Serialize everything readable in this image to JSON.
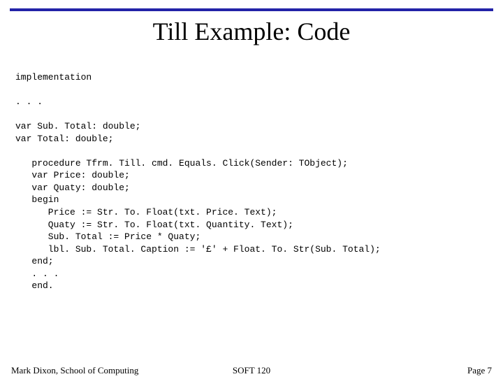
{
  "title": "Till Example: Code",
  "code": {
    "l0": "implementation",
    "l1": ". . .",
    "l2": "var Sub. Total: double;",
    "l3": "var Total: double;",
    "l4": "   procedure Tfrm. Till. cmd. Equals. Click(Sender: TObject);",
    "l5": "   var Price: double;",
    "l6": "   var Quaty: double;",
    "l7": "   begin",
    "l8": "      Price := Str. To. Float(txt. Price. Text);",
    "l9": "      Quaty := Str. To. Float(txt. Quantity. Text);",
    "l10": "      Sub. Total := Price * Quaty;",
    "l11": "      lbl. Sub. Total. Caption := '£' + Float. To. Str(Sub. Total);",
    "l12": "   end;",
    "l13": "   . . .",
    "l14": "   end."
  },
  "footer": {
    "left": "Mark Dixon, School of Computing",
    "center": "SOFT 120",
    "right": "Page 7"
  }
}
